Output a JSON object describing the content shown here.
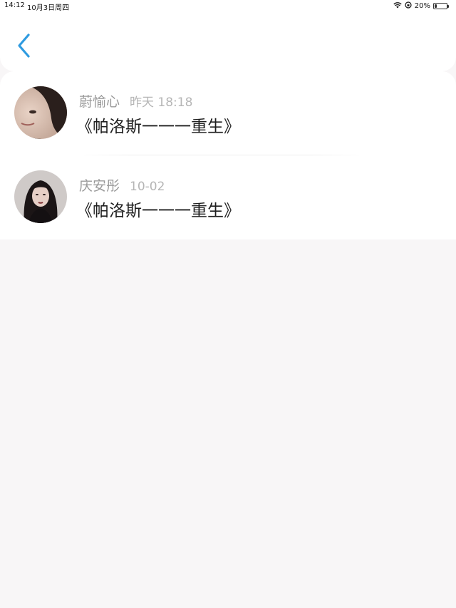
{
  "status_bar": {
    "time": "14:12",
    "date": "10月3日周四",
    "battery": "20%",
    "battery_level": 0.2,
    "icons": [
      "wifi-icon",
      "orientation-lock-icon",
      "battery-icon"
    ]
  },
  "nav": {
    "back_icon": "chevron-left-icon",
    "accent_color": "#2f9be0"
  },
  "items": [
    {
      "name": "蔚愉心",
      "time": "昨天 18:18",
      "title": "《帕洛斯一一一重生》",
      "avatar": "avatar-photo"
    },
    {
      "name": "庆安彤",
      "time": "10-02",
      "title": "《帕洛斯一一一重生》",
      "avatar": "avatar-photo"
    }
  ]
}
